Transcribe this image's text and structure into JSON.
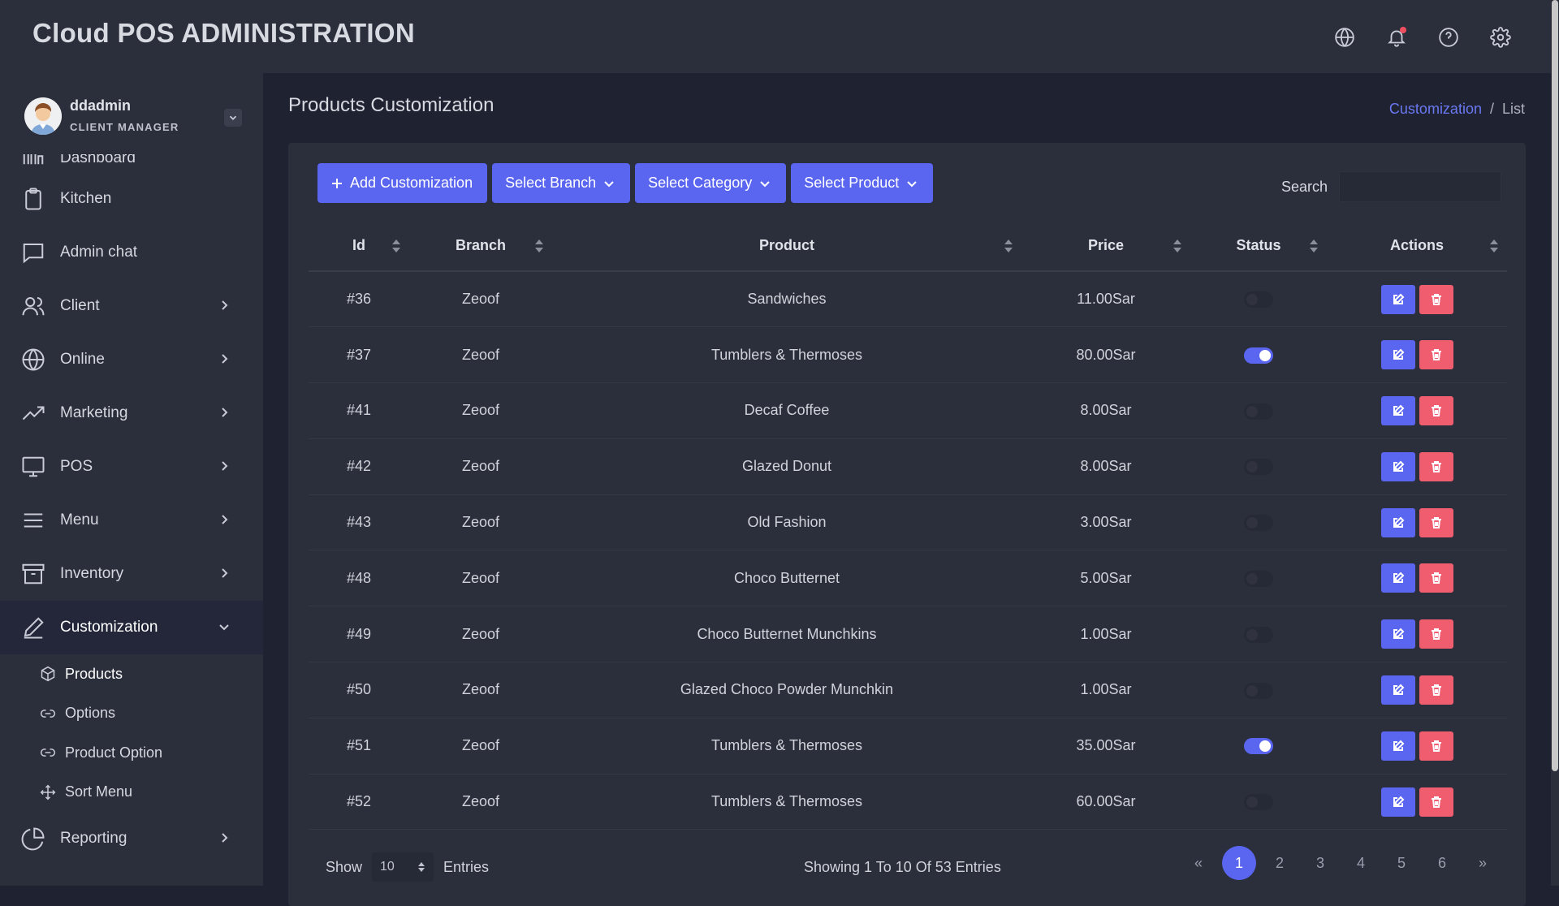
{
  "app": {
    "title": "Cloud POS ADMINISTRATION"
  },
  "topbar_icons": [
    "globe-icon",
    "bell-icon",
    "help-icon",
    "gear-icon"
  ],
  "user": {
    "name": "ddadmin",
    "role": "CLIENT MANAGER"
  },
  "sidebar": {
    "items": [
      {
        "label": "Dashboard",
        "icon": "dashboard-icon",
        "has_children": false
      },
      {
        "label": "Kitchen",
        "icon": "clipboard-icon",
        "has_children": false
      },
      {
        "label": "Admin chat",
        "icon": "chat-icon",
        "has_children": false
      },
      {
        "label": "Client",
        "icon": "users-icon",
        "has_children": true
      },
      {
        "label": "Online",
        "icon": "globe-icon",
        "has_children": true
      },
      {
        "label": "Marketing",
        "icon": "trend-icon",
        "has_children": true
      },
      {
        "label": "POS",
        "icon": "monitor-icon",
        "has_children": true
      },
      {
        "label": "Menu",
        "icon": "menu-icon",
        "has_children": true
      },
      {
        "label": "Inventory",
        "icon": "archive-icon",
        "has_children": true
      },
      {
        "label": "Customization",
        "icon": "pen-icon",
        "has_children": true,
        "expanded": true
      },
      {
        "label": "Reporting",
        "icon": "pie-icon",
        "has_children": true
      }
    ],
    "sub_items": [
      {
        "label": "Products",
        "icon": "cube-icon",
        "active": true
      },
      {
        "label": "Options",
        "icon": "link-icon"
      },
      {
        "label": "Product Option",
        "icon": "link-icon"
      },
      {
        "label": "Sort Menu",
        "icon": "move-icon"
      }
    ]
  },
  "main": {
    "title": "Products Customization",
    "breadcrumb": {
      "link": "Customization",
      "separator": "/",
      "current": "List"
    },
    "toolbar": {
      "add_label": "Add Customization",
      "branch_label": "Select Branch",
      "category_label": "Select Category",
      "product_label": "Select Product"
    },
    "search_label": "Search",
    "table": {
      "columns": [
        "Id",
        "Branch",
        "Product",
        "Price",
        "Status",
        "Actions"
      ],
      "rows": [
        {
          "id": "#36",
          "branch": "Zeoof",
          "product": "Sandwiches",
          "price": "11.00Sar",
          "status": false
        },
        {
          "id": "#37",
          "branch": "Zeoof",
          "product": "Tumblers & Thermoses",
          "price": "80.00Sar",
          "status": true
        },
        {
          "id": "#41",
          "branch": "Zeoof",
          "product": "Decaf Coffee",
          "price": "8.00Sar",
          "status": false
        },
        {
          "id": "#42",
          "branch": "Zeoof",
          "product": "Glazed Donut",
          "price": "8.00Sar",
          "status": false
        },
        {
          "id": "#43",
          "branch": "Zeoof",
          "product": "Old Fashion",
          "price": "3.00Sar",
          "status": false
        },
        {
          "id": "#48",
          "branch": "Zeoof",
          "product": "Choco Butternet",
          "price": "5.00Sar",
          "status": false
        },
        {
          "id": "#49",
          "branch": "Zeoof",
          "product": "Choco Butternet Munchkins",
          "price": "1.00Sar",
          "status": false
        },
        {
          "id": "#50",
          "branch": "Zeoof",
          "product": "Glazed Choco Powder Munchkin",
          "price": "1.00Sar",
          "status": false
        },
        {
          "id": "#51",
          "branch": "Zeoof",
          "product": "Tumblers & Thermoses",
          "price": "35.00Sar",
          "status": true
        },
        {
          "id": "#52",
          "branch": "Zeoof",
          "product": "Tumblers & Thermoses",
          "price": "60.00Sar",
          "status": false
        }
      ]
    },
    "footer": {
      "show_label": "Show",
      "entries_value": "10",
      "entries_label": "Entries",
      "showing_text": "Showing 1 To 10 Of 53 Entries",
      "pages": [
        "«",
        "1",
        "2",
        "3",
        "4",
        "5",
        "6",
        "»"
      ],
      "current_page": "1"
    }
  },
  "colors": {
    "accent": "#5a65f0",
    "danger": "#ef5d6e",
    "sidebar_bg": "#2b2e3b",
    "page_bg": "#1f2230"
  }
}
